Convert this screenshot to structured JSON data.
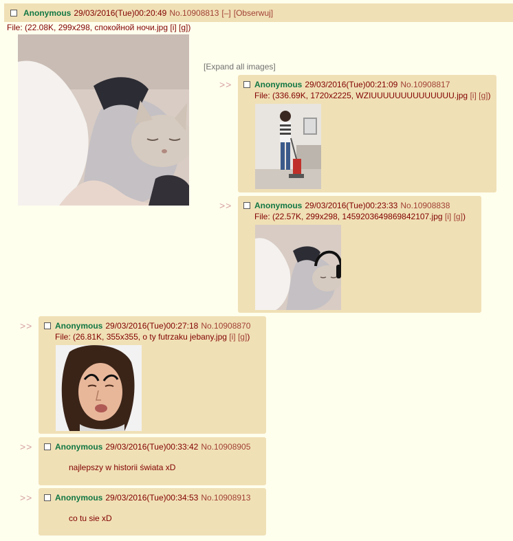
{
  "op": {
    "name": "Anonymous",
    "date": "29/03/2016(Tue)00:20:49",
    "number": "No.10908813",
    "hide": "[–]",
    "watch": "[Obserwuj]",
    "file_line": "File: (22.08K, 299x298, спокойной ночи.jpg [i] [g])"
  },
  "expand_all": "[Expand all images]",
  "reply_arrow": ">>",
  "replies": [
    {
      "name": "Anonymous",
      "date": "29/03/2016(Tue)00:21:09",
      "number": "No.10908817",
      "file_prefix": "File: (336.69K, 1720x2225, WZIUUUUUUUUUUUUUU.jpg",
      "file_i": "[i]",
      "file_g": "[g]",
      "file_suffix": ")"
    },
    {
      "name": "Anonymous",
      "date": "29/03/2016(Tue)00:23:33",
      "number": "No.10908838",
      "file_prefix": "File: (22.57K, 299x298, 1459203649869842107.jpg",
      "file_i": "[i]",
      "file_g": "[g]",
      "file_suffix": ")"
    },
    {
      "name": "Anonymous",
      "date": "29/03/2016(Tue)00:27:18",
      "number": "No.10908870",
      "file_prefix": "File: (26.81K, 355x355, o ty futrzaku jebany.jpg",
      "file_i": "[i]",
      "file_g": "[g]",
      "file_suffix": ")"
    },
    {
      "name": "Anonymous",
      "date": "29/03/2016(Tue)00:33:42",
      "number": "No.10908905",
      "text": "najlepszy w historii świata xD"
    },
    {
      "name": "Anonymous",
      "date": "29/03/2016(Tue)00:34:53",
      "number": "No.10908913",
      "text": "co tu sie xD"
    }
  ]
}
